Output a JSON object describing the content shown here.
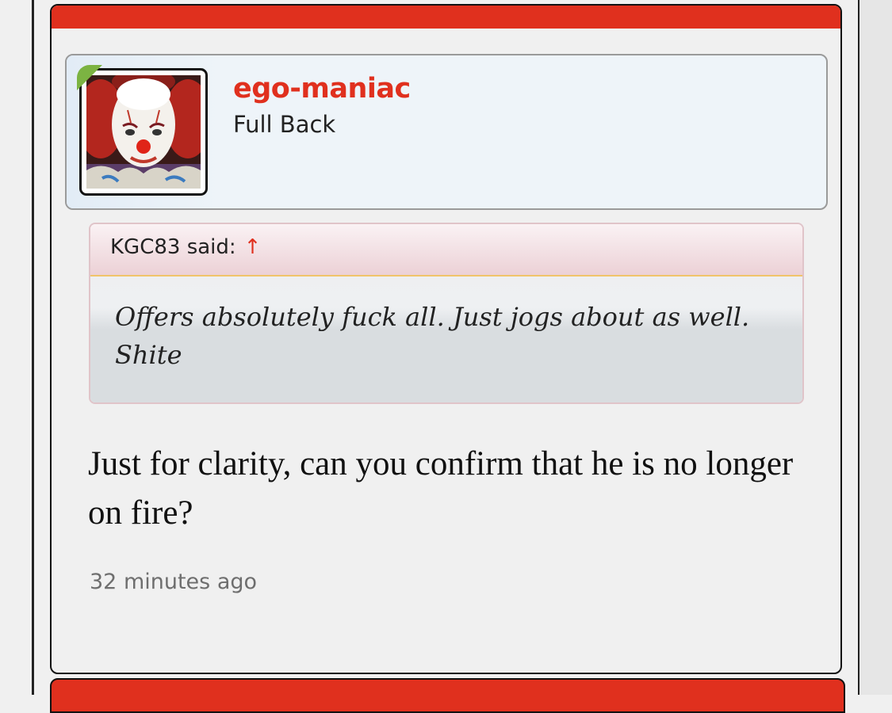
{
  "post": {
    "author": {
      "username": "ego-maniac",
      "title": "Full Back",
      "online": true,
      "avatar_icon": "clown-avatar-icon"
    },
    "quote": {
      "attribution": "KGC83 said:",
      "jump_icon": "↑",
      "text": "Offers absolutely fuck all. Just jogs about as well. Shite"
    },
    "message": "Just for clarity, can you confirm that he is no longer on fire?",
    "timestamp": "32 minutes ago"
  },
  "colors": {
    "accent": "#e0301e",
    "online_badge": "#7cb342",
    "background": "#f0f0f0"
  }
}
